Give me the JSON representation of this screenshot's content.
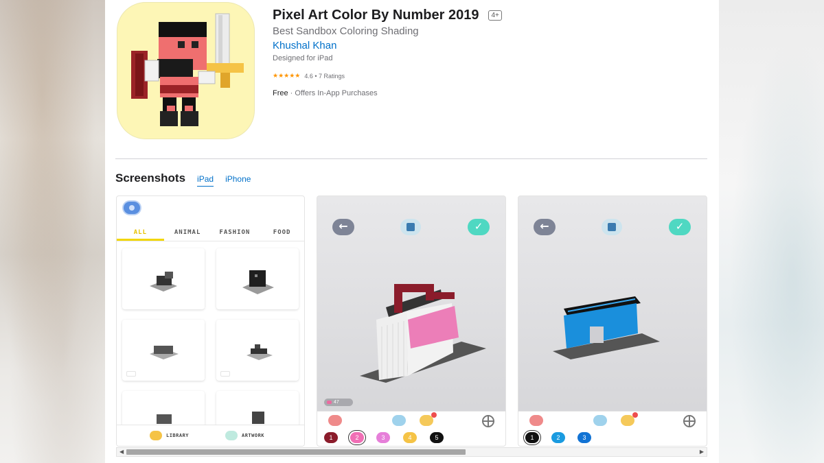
{
  "app": {
    "title": "Pixel Art Color By Number 2019",
    "age_rating": "4+",
    "subtitle": "Best Sandbox Coloring Shading",
    "developer": "Khushal Khan",
    "designed_for": "Designed for iPad",
    "stars": "★★★★★",
    "rating_text": "4.6 • 7 Ratings",
    "price": "Free",
    "price_note": " · Offers In-App Purchases"
  },
  "screenshots": {
    "title": "Screenshots",
    "tabs": [
      {
        "label": "iPad",
        "active": true
      },
      {
        "label": "iPhone",
        "active": false
      }
    ]
  },
  "shot1": {
    "categories": [
      "ALL",
      "ANIMAL",
      "FASHION",
      "FOOD"
    ],
    "bottom_buttons": [
      "LIBRARY",
      "ARTWORK"
    ]
  },
  "shot2": {
    "progress": "47",
    "swatches": [
      "1",
      "2",
      "3",
      "4",
      "5"
    ],
    "swatch_colors": [
      "#8b1c2b",
      "#f06fb5",
      "#e67fd9",
      "#f5c346",
      "#111111"
    ]
  },
  "shot3": {
    "swatches": [
      "1",
      "2",
      "3"
    ],
    "swatch_colors": [
      "#111111",
      "#1a9be0",
      "#1273d4"
    ]
  },
  "colors": {
    "link": "#0070c9",
    "star": "#ff9500",
    "icon_bg": "#fdf6b6"
  }
}
